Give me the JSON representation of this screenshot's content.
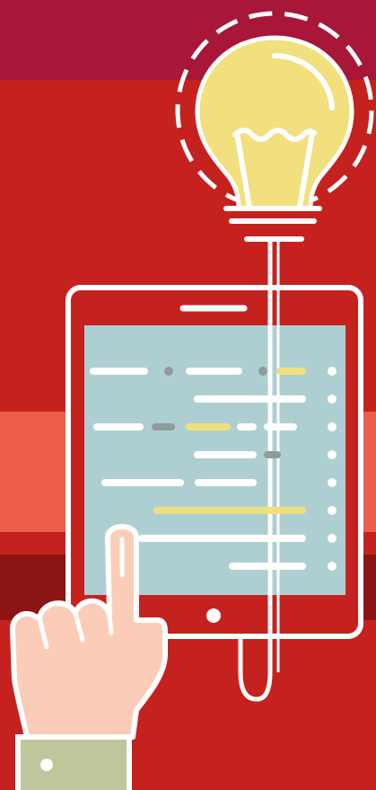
{
  "palette": {
    "background": "#c5221f",
    "top_band": "#a8163a",
    "light_band": "#ec5e49",
    "dark_band": "#8b1414",
    "screen": "#aecfd2",
    "bulb": "#f2df7e",
    "code_white": "#ffffff",
    "code_gray": "#8f9a9b",
    "code_yellow": "#efe07e",
    "skin": "#fbcdb9",
    "sleeve": "#c0c59c",
    "outline": "#ffffff"
  },
  "icons": {
    "lightbulb": "lightbulb-icon",
    "tablet": "tablet-icon",
    "hand": "pointing-hand-icon"
  }
}
